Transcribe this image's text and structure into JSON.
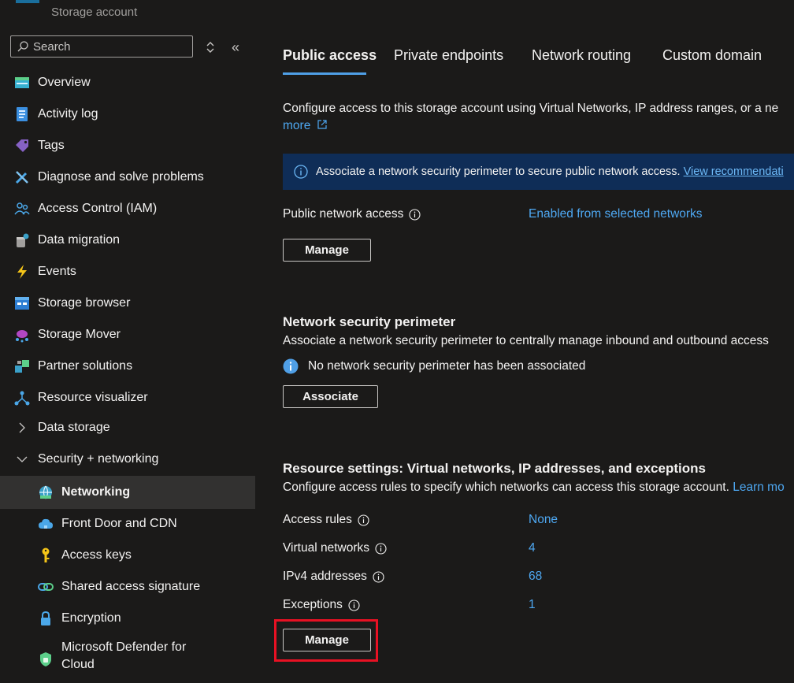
{
  "sidebar": {
    "resource_type": "Storage account",
    "search_placeholder": "Search",
    "items": [
      {
        "label": "Overview",
        "icon": "overview-icon"
      },
      {
        "label": "Activity log",
        "icon": "activity-log-icon"
      },
      {
        "label": "Tags",
        "icon": "tag-icon"
      },
      {
        "label": "Diagnose and solve problems",
        "icon": "wrench-icon"
      },
      {
        "label": "Access Control (IAM)",
        "icon": "people-icon"
      },
      {
        "label": "Data migration",
        "icon": "data-migration-icon"
      },
      {
        "label": "Events",
        "icon": "lightning-icon"
      },
      {
        "label": "Storage browser",
        "icon": "storage-browser-icon"
      },
      {
        "label": "Storage Mover",
        "icon": "storage-mover-icon"
      },
      {
        "label": "Partner solutions",
        "icon": "partner-icon"
      },
      {
        "label": "Resource visualizer",
        "icon": "visualizer-icon"
      },
      {
        "label": "Data storage",
        "icon": "chevron-right-icon"
      },
      {
        "label": "Security + networking",
        "icon": "chevron-down-icon"
      },
      {
        "label": "Networking",
        "icon": "networking-icon"
      },
      {
        "label": "Front Door and CDN",
        "icon": "cloud-icon"
      },
      {
        "label": "Access keys",
        "icon": "key-icon"
      },
      {
        "label": "Shared access signature",
        "icon": "link-icon"
      },
      {
        "label": "Encryption",
        "icon": "lock-icon"
      },
      {
        "label": "Microsoft Defender for Cloud",
        "icon": "shield-icon"
      }
    ]
  },
  "tabs": [
    "Public access",
    "Private endpoints",
    "Network routing",
    "Custom domain"
  ],
  "public_access": {
    "description": "Configure access to this storage account using Virtual Networks, IP address ranges, or a ne",
    "learn_more": "more",
    "banner_text": "Associate a network security perimeter to secure public network access.",
    "banner_link": "View recommendati",
    "public_network_access_label": "Public network access",
    "public_network_access_value": "Enabled from selected networks",
    "manage_label": "Manage"
  },
  "nsp": {
    "title": "Network security perimeter",
    "description": "Associate a network security perimeter to centrally manage inbound and outbound access",
    "status": "No network security perimeter has been associated",
    "associate_label": "Associate"
  },
  "resource_settings": {
    "title": "Resource settings: Virtual networks, IP addresses, and exceptions",
    "description": "Configure access rules to specify which networks can access this storage account.",
    "learn_more": "Learn mo",
    "rows": [
      {
        "label": "Access rules",
        "value": "None"
      },
      {
        "label": "Virtual networks",
        "value": "4"
      },
      {
        "label": "IPv4 addresses",
        "value": "68"
      },
      {
        "label": "Exceptions",
        "value": "1"
      }
    ],
    "manage_label": "Manage"
  },
  "colors": {
    "background": "#1b1a19",
    "accent": "#4f9fe6",
    "link": "#4ea8f2",
    "banner": "#0f2d57",
    "highlight": "#e81123"
  }
}
